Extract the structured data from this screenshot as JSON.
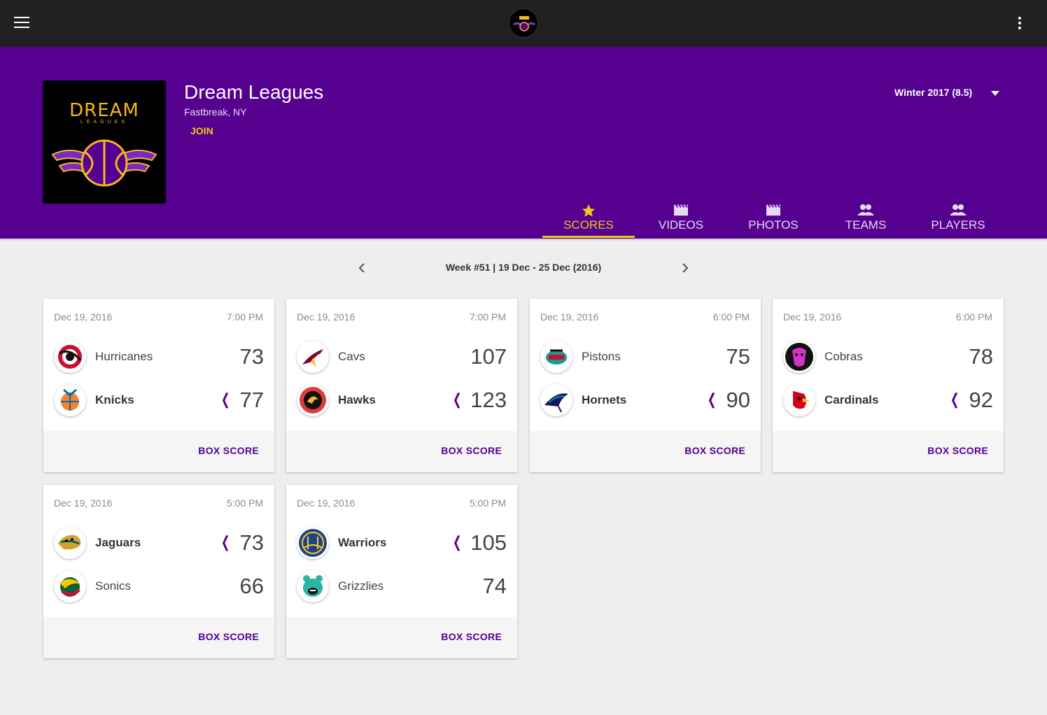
{
  "league": {
    "name": "Dream Leagues",
    "location": "Fastbreak, NY",
    "join_label": "JOIN",
    "logo_text": "DREAM",
    "logo_subtext": "LEAGUES",
    "season": "Winter 2017 (8.5)"
  },
  "tabs": [
    {
      "label": "SCORES",
      "icon": "star-icon",
      "active": true
    },
    {
      "label": "VIDEOS",
      "icon": "video-icon"
    },
    {
      "label": "PHOTOS",
      "icon": "photo-icon"
    },
    {
      "label": "TEAMS",
      "icon": "people-icon"
    },
    {
      "label": "PLAYERS",
      "icon": "people-icon"
    }
  ],
  "week": {
    "label": "Week #51 | 19 Dec - 25 Dec (2016)"
  },
  "games": [
    {
      "date": "Dec 19, 2016",
      "time": "7:00 PM",
      "box_label": "BOX SCORE",
      "home": {
        "name": "Hurricanes",
        "score": "73"
      },
      "away": {
        "name": "Knicks",
        "score": "77"
      },
      "winner": "away"
    },
    {
      "date": "Dec 19, 2016",
      "time": "7:00 PM",
      "box_label": "BOX SCORE",
      "home": {
        "name": "Cavs",
        "score": "107"
      },
      "away": {
        "name": "Hawks",
        "score": "123"
      },
      "winner": "away"
    },
    {
      "date": "Dec 19, 2016",
      "time": "6:00 PM",
      "box_label": "BOX SCORE",
      "home": {
        "name": "Pistons",
        "score": "75"
      },
      "away": {
        "name": "Hornets",
        "score": "90"
      },
      "winner": "away"
    },
    {
      "date": "Dec 19, 2016",
      "time": "6:00 PM",
      "box_label": "BOX SCORE",
      "home": {
        "name": "Cobras",
        "score": "78"
      },
      "away": {
        "name": "Cardinals",
        "score": "92"
      },
      "winner": "away"
    },
    {
      "date": "Dec 19, 2016",
      "time": "5:00 PM",
      "box_label": "BOX SCORE",
      "home": {
        "name": "Jaguars",
        "score": "73"
      },
      "away": {
        "name": "Sonics",
        "score": "66"
      },
      "winner": "home"
    },
    {
      "date": "Dec 19, 2016",
      "time": "5:00 PM",
      "box_label": "BOX SCORE",
      "home": {
        "name": "Warriors",
        "score": "105"
      },
      "away": {
        "name": "Grizzlies",
        "score": "74"
      },
      "winner": "home"
    }
  ],
  "colors": {
    "primary": "#55008f",
    "accent": "#f5c518",
    "appbar": "#212121"
  }
}
